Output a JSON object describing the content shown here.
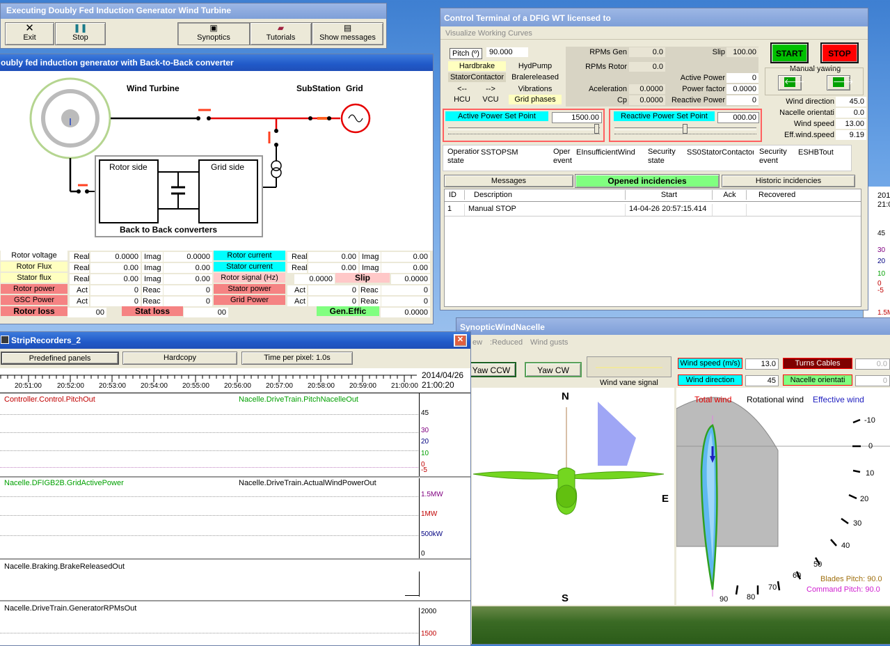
{
  "colors": {
    "titlebar": "#2059c8",
    "panel": "#ece9d8",
    "wire_red": "#e60000",
    "start": "#00c000",
    "stop": "#ff0000",
    "cyan": "#00ffff",
    "rotor_green": "#74d620"
  },
  "main": {
    "title": "Executing Doubly Fed Induction Generator Wind Turbine",
    "toolbar": [
      {
        "label": "Exit",
        "icon": "close-icon"
      },
      {
        "label": "Stop",
        "icon": "pause-icon"
      },
      {
        "label": "Synoptics",
        "icon": "synoptics-icon"
      },
      {
        "label": "Tutorials",
        "icon": "book-icon"
      },
      {
        "label": "Show messages",
        "icon": "messages-icon"
      }
    ]
  },
  "dfig": {
    "title": "oubly fed induction generator with Back-to-Back converter",
    "labels": {
      "wind_turbine": "Wind Turbine",
      "substation": "SubStation",
      "grid": "Grid",
      "rotor_side": "Rotor side",
      "grid_side": "Grid side",
      "b2b": "Back to Back converters"
    },
    "left": [
      {
        "label": "Rotor voltage",
        "a": "Real",
        "av": "0.0000",
        "b": "Imag",
        "bv": "0.0000"
      },
      {
        "label": "Rotor Flux",
        "a": "Real",
        "av": "0.00",
        "b": "Imag",
        "bv": "0.00"
      },
      {
        "label": "Stator flux",
        "a": "Real",
        "av": "0.00",
        "b": "Imag",
        "bv": "0.00"
      },
      {
        "label": "Rotor power",
        "a": "Act",
        "av": "0",
        "b": "Reac",
        "bv": "0"
      },
      {
        "label": "GSC Power",
        "a": "Act",
        "av": "0",
        "b": "Reac",
        "bv": "0"
      }
    ],
    "right": [
      {
        "label": "Rotor current",
        "a": "Real",
        "av": "0.00",
        "b": "Imag",
        "bv": "0.00"
      },
      {
        "label": "Stator current",
        "a": "Real",
        "av": "0.00",
        "b": "Imag",
        "bv": "0.00"
      },
      {
        "label": "Stator power",
        "a": "Act",
        "av": "0",
        "b": "Reac",
        "bv": "0"
      },
      {
        "label": "Grid Power",
        "a": "Act",
        "av": "0",
        "b": "Reac",
        "bv": "0"
      }
    ],
    "rotor_signal_label": "Rotor signal (Hz)",
    "rotor_signal": "0.0000",
    "slip_label": "Slip",
    "slip": "0.0000",
    "rotor_loss_label": "Rotor loss",
    "rotor_loss": "00",
    "stat_loss_label": "Stat loss",
    "stat_loss": "00",
    "gen_effic_label": "Gen.Effic",
    "gen_effic": "0.0000"
  },
  "control": {
    "title": "Control Terminal of a DFIG WT licensed to",
    "menu": "Visualize Working Curves",
    "pitch_label": "Pitch (º)",
    "pitch": "90.000",
    "status": [
      [
        "Hardbrake",
        "HydPump"
      ],
      [
        "StatorContactor",
        "Bralereleased"
      ],
      [
        "<--",
        "-->"
      ],
      [
        "HCU",
        "VCU"
      ]
    ],
    "vibrations": "Vibrations",
    "grid_phases": "Grid phases",
    "rpms_gen_label": "RPMs Gen",
    "rpms_gen": "0.0",
    "rpms_rotor_label": "RPMs Rotor",
    "rpms_rotor": "0.0",
    "slip_label": "Slip",
    "slip": "100.00",
    "active_power_label": "Active Power",
    "active_power": "0",
    "acel_label": "Aceleration",
    "acel": "0.0000",
    "pf_label": "Power factor",
    "pf": "0.0000",
    "cp_label": "Cp",
    "cp": "0.0000",
    "reactive_label": "Reactive Power",
    "reactive": "0",
    "start": "START",
    "stop": "STOP",
    "manual_yawing": "Manual yawing",
    "wind": [
      [
        "Wind direction",
        "45.0"
      ],
      [
        "Nacelle orientati",
        "0.0"
      ],
      [
        "Wind speed",
        "13.00"
      ],
      [
        "Eff.wind.speed",
        "9.19"
      ]
    ],
    "active_sp_label": "Active Power Set Point",
    "active_sp": "1500.00",
    "reactive_sp_label": "Reactive Power Set Point",
    "reactive_sp": "000.00",
    "op_state_label": "Operatior state",
    "op_state": "SSTOPSM",
    "oper_event_label": "Oper event",
    "oper_event": "EInsufficientWind",
    "sec_state_label": "Security state",
    "sec_state": "SS0StatorContactor0",
    "sec_event_label": "Security event",
    "sec_event": "ESHBTout",
    "tabs": [
      "Messages",
      "Opened incidencies",
      "Historic incidencies"
    ],
    "table_headers": [
      "ID",
      "Description",
      "Start",
      "Ack",
      "Recovered"
    ],
    "rows": [
      [
        "1",
        "Manual STOP",
        "14-04-26 20:57:15.414",
        "",
        ""
      ]
    ]
  },
  "strip": {
    "title": "StripRecorders_2",
    "buttons": [
      "Predefined panels",
      "Hardcopy",
      "Time per pixel: 1.0s"
    ],
    "times": [
      "20:51:00",
      "20:52:00",
      "20:53:00",
      "20:54:00",
      "20:55:00",
      "20:56:00",
      "20:57:00",
      "20:58:00",
      "20:59:00",
      "21:00:00"
    ],
    "date": "2014/04/26",
    "clock": "21:00:20",
    "p1": {
      "a": "Controller.Control.PitchOut",
      "b": "Nacelle.DriveTrain.PitchNacelleOut",
      "ticks": [
        "45",
        "30",
        "20",
        "10",
        "0",
        "-5"
      ]
    },
    "p2": {
      "a": "Nacelle.DFIGB2B.GridActivePower",
      "b": "Nacelle.DriveTrain.ActualWindPowerOut",
      "ticks": [
        "1.5MW",
        "1MW",
        "500kW",
        "0"
      ]
    },
    "p3": {
      "a": "Nacelle.Braking.BrakeReleasedOut"
    },
    "p4": {
      "a": "Nacelle.DriveTrain.GeneratorRPMsOut",
      "ticks": [
        "2000",
        "1500"
      ]
    }
  },
  "bg": {
    "date": "201",
    "time": "21:0",
    "ticks": [
      "45",
      "30",
      "20",
      "10",
      "0",
      "-5"
    ],
    "mw": "1.5M"
  },
  "nacelle": {
    "title": "SynopticWindNacelle",
    "menu": [
      "ew",
      ":Reduced",
      "Wind gusts"
    ],
    "yaw_ccw": "Yaw CCW",
    "yaw_cw": "Yaw CW",
    "vane_label": "Wind vane signal",
    "ws_label": "Wind speed (m/s)",
    "ws": "13.0",
    "wd_label": "Wind direction",
    "wd": "45",
    "tc_label": "Turns Cables",
    "tc": "0.0",
    "no_label": "Nacelle orientati",
    "no": "0",
    "compass": {
      "n": "N",
      "e": "E",
      "s": "S"
    },
    "legend": [
      "Total wind",
      "Rotational wind",
      "Effective wind"
    ],
    "pitch_ticks": [
      "-10",
      "0",
      "10",
      "20",
      "30",
      "40",
      "50",
      "60",
      "70",
      "80",
      "90"
    ],
    "blades_pitch": "Blades Pitch: 90.0",
    "command_pitch": "Command Pitch: 90.0"
  }
}
